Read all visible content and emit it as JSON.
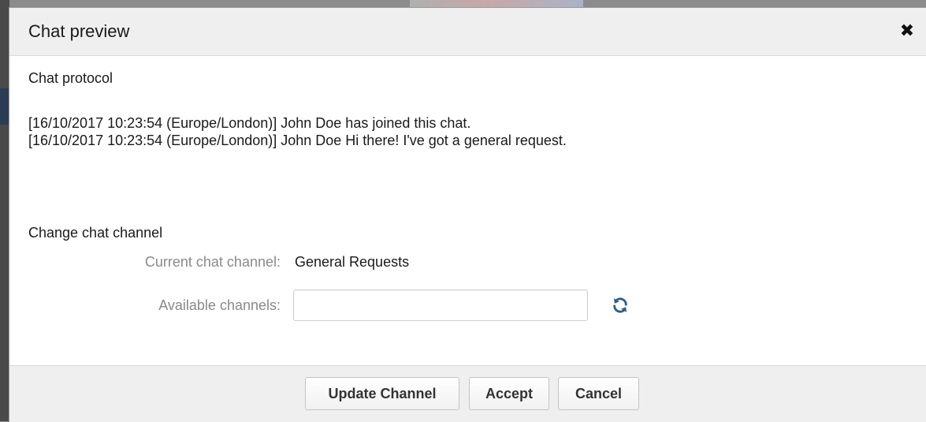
{
  "dialog": {
    "title": "Chat preview",
    "close_symbol": "✖"
  },
  "chat_protocol": {
    "heading": "Chat protocol",
    "messages": [
      "[16/10/2017 10:23:54 (Europe/London)] John Doe has joined this chat.",
      "[16/10/2017 10:23:54 (Europe/London)] John Doe Hi there! I've got a general request."
    ]
  },
  "change_channel": {
    "heading": "Change chat channel",
    "current_label": "Current chat channel:",
    "current_value": "General Requests",
    "available_label": "Available channels:",
    "available_value": "",
    "refresh_icon": "refresh-icon"
  },
  "footer": {
    "update_button": "Update Channel",
    "accept_button": "Accept",
    "cancel_button": "Cancel"
  },
  "colors": {
    "header_bg": "#efefef",
    "label_gray": "#8a8a8a",
    "refresh_icon_blue": "#2d5f86"
  }
}
